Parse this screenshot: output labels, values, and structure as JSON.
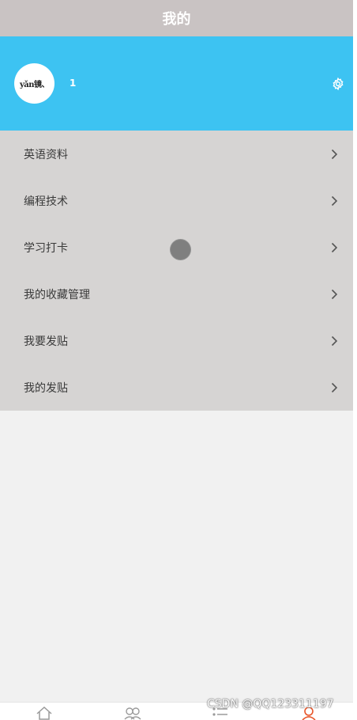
{
  "header": {
    "title": "我的"
  },
  "profile": {
    "avatar_text": "yǎn镜、",
    "username": "1"
  },
  "menu": {
    "items": [
      {
        "label": "英语资料"
      },
      {
        "label": "编程技术"
      },
      {
        "label": "学习打卡"
      },
      {
        "label": "我的收藏管理"
      },
      {
        "label": "我要发贴"
      },
      {
        "label": "我的发贴"
      }
    ]
  },
  "tabbar": {
    "icons": [
      "home-icon",
      "community-icon",
      "list-icon",
      "profile-icon"
    ],
    "active_color": "#e8562a",
    "inactive_color": "#9a9a9a"
  },
  "watermark": {
    "text": "CSDN @QQ123311197"
  },
  "colors": {
    "header_bg": "#c9c3c3",
    "profile_bg": "#3dc3f2",
    "menu_bg": "#d6d4d3",
    "page_bg": "#f1f1f1"
  }
}
